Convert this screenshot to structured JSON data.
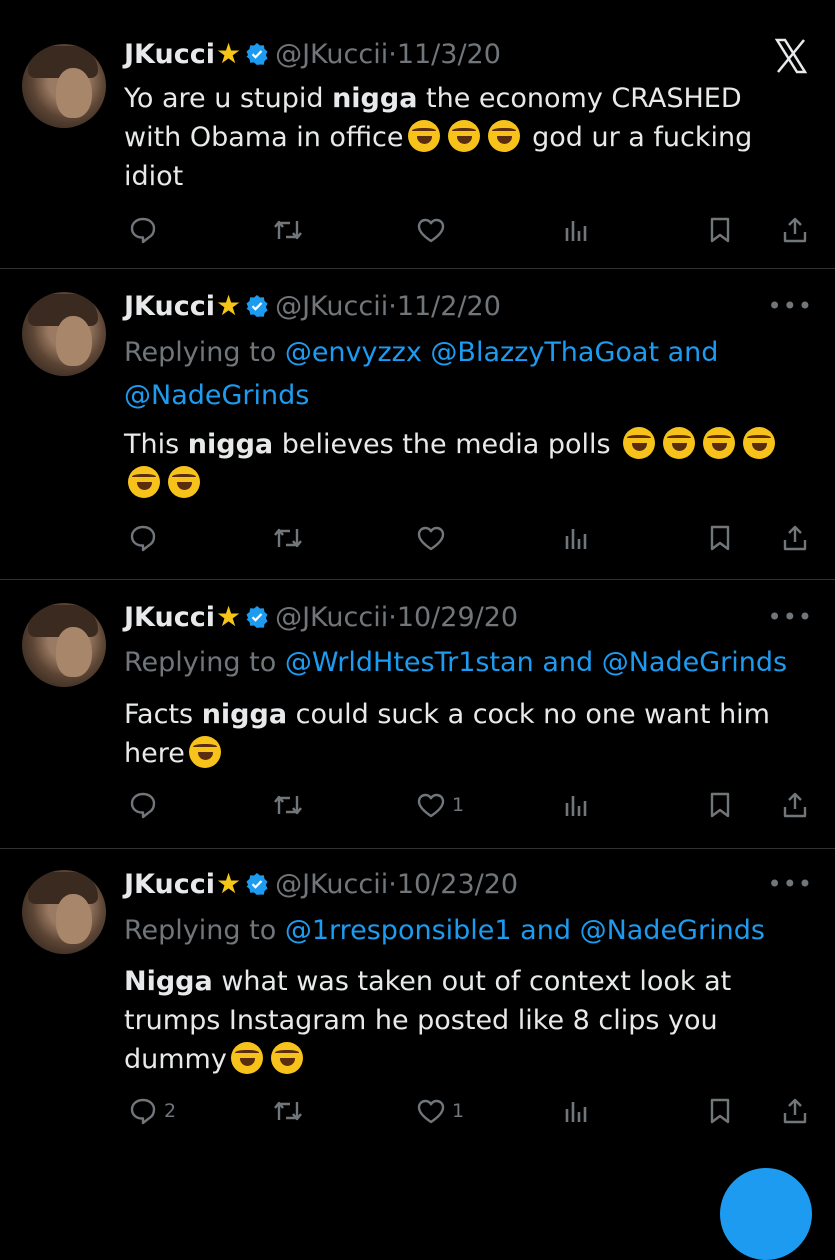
{
  "tweets": [
    {
      "name": "JKucci",
      "handle": "@JKuccii",
      "date": "11/3/20",
      "reply_prefix": "",
      "mentions": [],
      "body": {
        "p1": "Yo are u stupid ",
        "b1": "nigga",
        "p2": " the economy CRASHED with Obama in office",
        "p3": " god ur a fucking idiot"
      },
      "stats": {
        "replies": "",
        "likes": ""
      }
    },
    {
      "name": "JKucci",
      "handle": "@JKuccii",
      "date": "11/2/20",
      "reply_prefix": "Replying to ",
      "mentions": [
        "@envyzzx",
        "@BlazzyThaGoat",
        "and",
        "@NadeGrinds"
      ],
      "body": {
        "p1": "This ",
        "b1": "nigga",
        "p2": " believes the media polls "
      },
      "stats": {
        "replies": "",
        "likes": ""
      }
    },
    {
      "name": "JKucci",
      "handle": "@JKuccii",
      "date": "10/29/20",
      "reply_prefix": "Replying to ",
      "mentions": [
        "@WrldHtesTr1stan",
        "and",
        "@NadeGrinds"
      ],
      "body": {
        "p1": "Facts ",
        "b1": "nigga",
        "p2": " could suck a cock no one want him here"
      },
      "stats": {
        "replies": "",
        "likes": "1"
      }
    },
    {
      "name": "JKucci",
      "handle": "@JKuccii",
      "date": "10/23/20",
      "reply_prefix": "Replying to ",
      "mentions": [
        "@1rresponsible1",
        "and",
        "@NadeGrinds"
      ],
      "body": {
        "b1": "Nigga",
        "p1": " what was taken out of context look at trumps Instagram he posted like 8 clips you dummy"
      },
      "stats": {
        "replies": "2",
        "likes": "1"
      }
    }
  ],
  "separator": "·",
  "icons": [
    "avatar",
    "star-emoji",
    "verified-badge-icon",
    "x-close-icon",
    "more-icon",
    "reply-icon",
    "retweet-icon",
    "like-icon",
    "views-icon",
    "bookmark-icon",
    "share-icon",
    "rofl-emoji",
    "joy-cat-emoji"
  ],
  "colors": {
    "background": "#000000",
    "text": "#e7e9ea",
    "muted": "#71767b",
    "accent": "#1d9bf0",
    "star": "#f5c518"
  },
  "fab": {
    "icon": "compose-fab"
  }
}
